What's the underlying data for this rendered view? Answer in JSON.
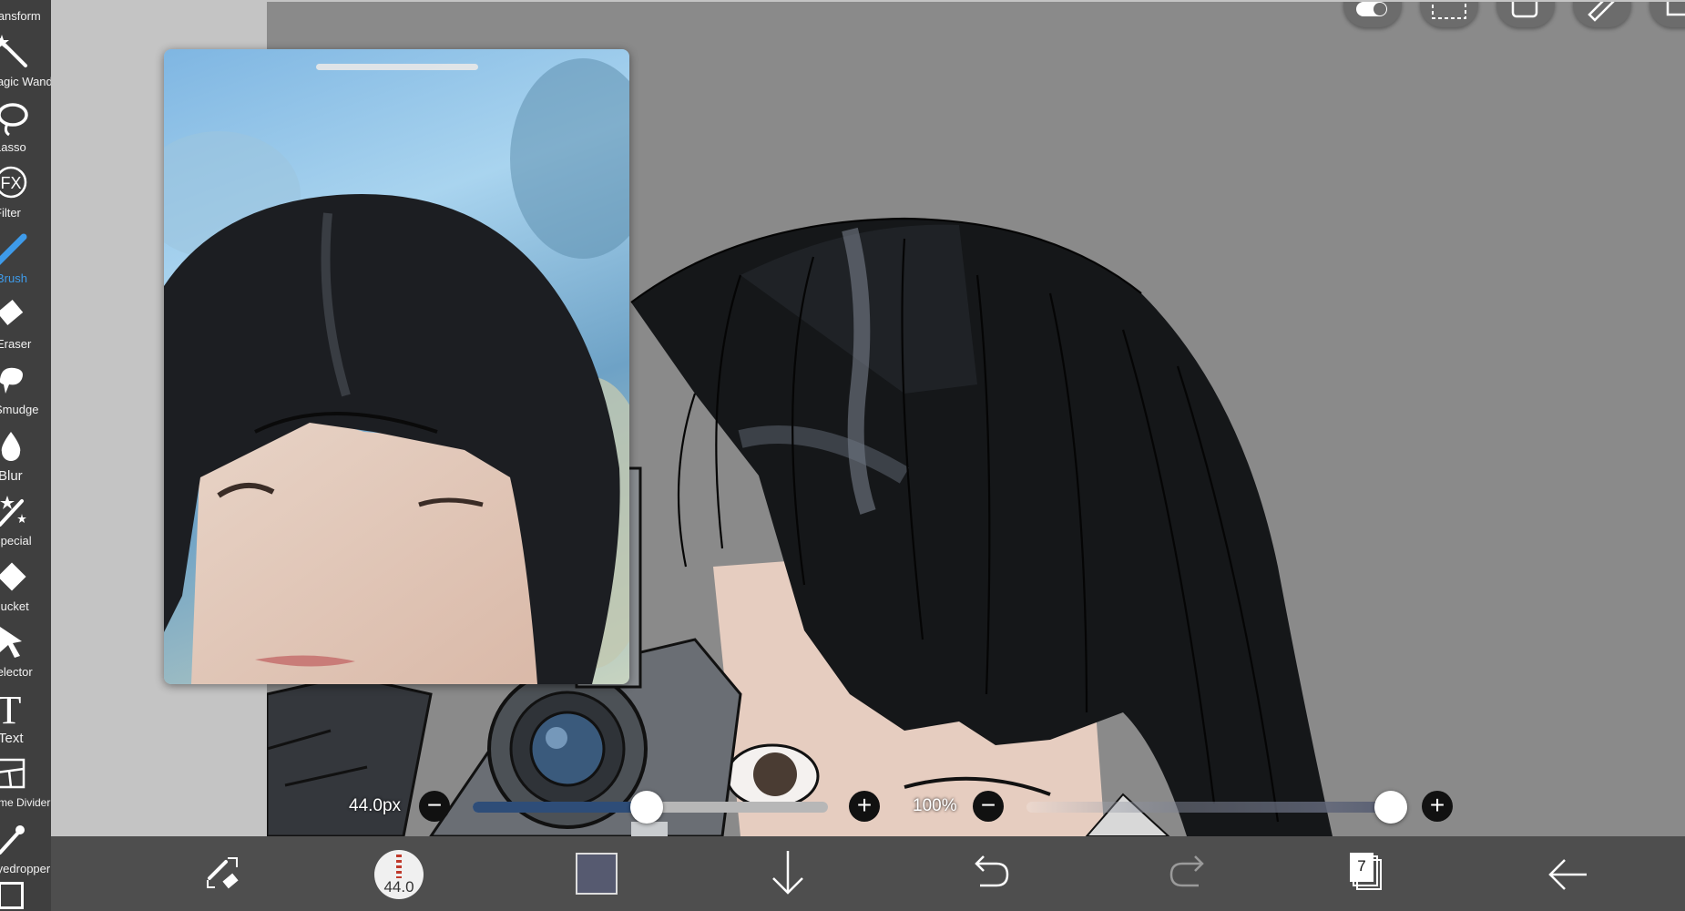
{
  "tools": [
    {
      "label": "Transform"
    },
    {
      "label": "Magic Wand"
    },
    {
      "label": "Lasso"
    },
    {
      "label": "Filter",
      "icon_text": "FX"
    },
    {
      "label": "Brush",
      "active": true
    },
    {
      "label": "Eraser"
    },
    {
      "label": "Smudge"
    },
    {
      "label": "Blur"
    },
    {
      "label": "Special"
    },
    {
      "label": "Bucket"
    },
    {
      "label": "Selector"
    },
    {
      "label": "Text",
      "icon_text": "T"
    },
    {
      "label": "Frame Divider"
    },
    {
      "label": "Eyedropper"
    }
  ],
  "brush_size": {
    "value_text": "44.0px",
    "level": 0.49
  },
  "opacity": {
    "value_text": "100%",
    "level": 1.0
  },
  "bottom_toolbar": {
    "brush_preview_text": "44.0",
    "layers_count": "7",
    "current_color": "#565a70"
  },
  "icons": {
    "top_right": [
      "toggle-icon",
      "selection-icon",
      "square-icon",
      "ruler-icon",
      "menu-icon"
    ],
    "bottom": [
      "swap-tools-icon",
      "brush-preview-icon",
      "color-swatch-icon",
      "download-icon",
      "undo-icon",
      "redo-icon",
      "layers-icon",
      "back-arrow-icon"
    ]
  },
  "colors": {
    "accent": "#3e9bea",
    "rail_bg": "#3f3f3f",
    "canvas_bg": "#8a8a8a",
    "slider_fill": "#2e4d78"
  }
}
